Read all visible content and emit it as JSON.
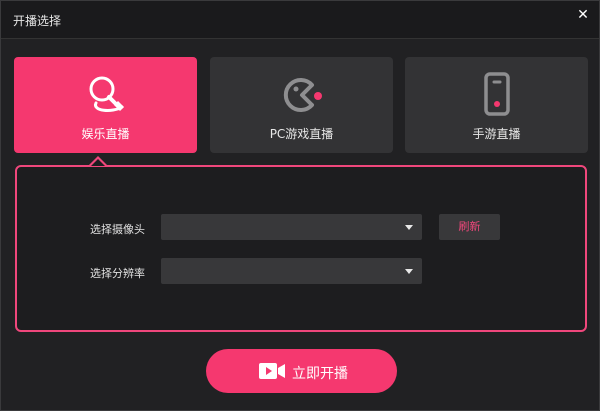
{
  "window": {
    "title": "开播选择",
    "close_symbol": "✕"
  },
  "modes": [
    {
      "label": "娱乐直播",
      "icon": "microphone-icon",
      "active": true
    },
    {
      "label": "PC游戏直播",
      "icon": "pacman-icon",
      "active": false
    },
    {
      "label": "手游直播",
      "icon": "phone-icon",
      "active": false
    }
  ],
  "settings": {
    "camera_label": "选择摄像头",
    "camera_value": "",
    "refresh_label": "刷新",
    "resolution_label": "选择分辨率",
    "resolution_value": ""
  },
  "action": {
    "start_label": "立即开播",
    "icon": "video-camera-icon"
  },
  "colors": {
    "accent": "#f5386f",
    "panel_border": "#f0477c",
    "background": "#212123",
    "card_inactive": "#333335"
  }
}
